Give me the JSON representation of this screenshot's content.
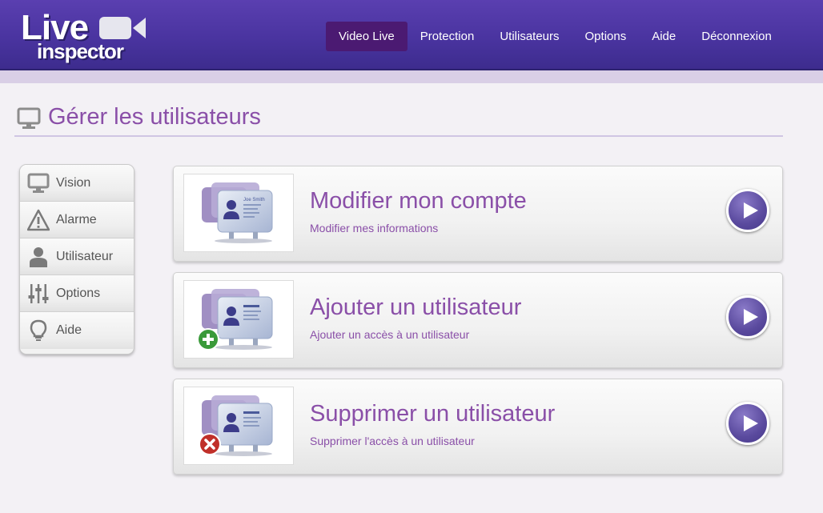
{
  "logo": {
    "line1": "Live",
    "line2": "inspector"
  },
  "nav": [
    {
      "label": "Video Live",
      "active": true
    },
    {
      "label": "Protection",
      "active": false
    },
    {
      "label": "Utilisateurs",
      "active": false
    },
    {
      "label": "Options",
      "active": false
    },
    {
      "label": "Aide",
      "active": false
    },
    {
      "label": "Déconnexion",
      "active": false
    }
  ],
  "page": {
    "title": "Gérer les utilisateurs",
    "icon": "monitor-icon"
  },
  "sidebar": {
    "items": [
      {
        "label": "Vision",
        "icon": "monitor-icon"
      },
      {
        "label": "Alarme",
        "icon": "warning-icon"
      },
      {
        "label": "Utilisateur",
        "icon": "user-icon"
      },
      {
        "label": "Options",
        "icon": "sliders-icon"
      },
      {
        "label": "Aide",
        "icon": "lightbulb-icon"
      }
    ]
  },
  "cards": [
    {
      "title": "Modifier mon compte",
      "subtitle": "Modifier mes informations",
      "badge": "none",
      "card_text": "Joe Smith"
    },
    {
      "title": "Ajouter un utilisateur",
      "subtitle": "Ajouter un accès à un utilisateur",
      "badge": "add"
    },
    {
      "title": "Supprimer un utilisateur",
      "subtitle": "Supprimer l'accès à un utilisateur",
      "badge": "remove"
    }
  ],
  "colors": {
    "accent": "#8a4fa8",
    "header": "#4a34a0",
    "nav_active": "#4b1a72",
    "add_badge": "#3a9a3a",
    "remove_badge": "#c0302a"
  }
}
